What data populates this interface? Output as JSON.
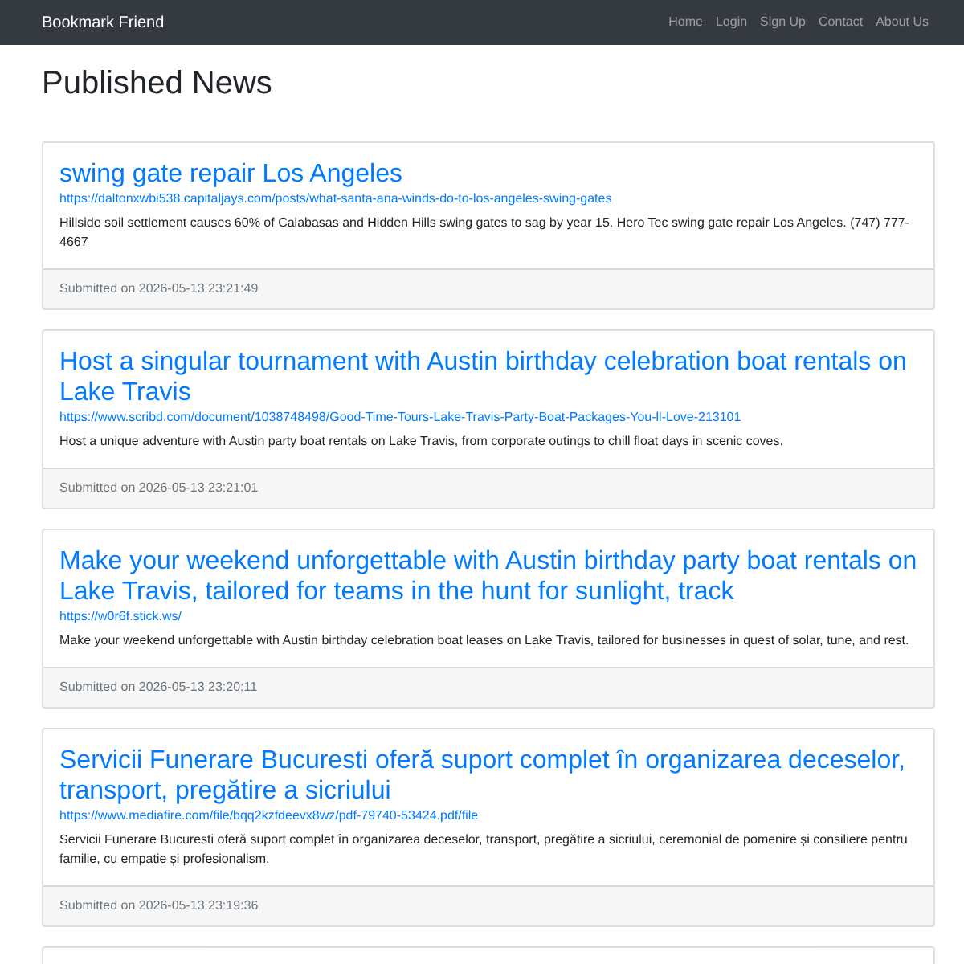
{
  "navbar": {
    "brand": "Bookmark Friend",
    "links": [
      {
        "label": "Home"
      },
      {
        "label": "Login"
      },
      {
        "label": "Sign Up"
      },
      {
        "label": "Contact"
      },
      {
        "label": "About Us"
      }
    ]
  },
  "page_title": "Published News",
  "posts": [
    {
      "title": "swing gate repair Los Angeles",
      "url": "https://daltonxwbi538.capitaljays.com/posts/what-santa-ana-winds-do-to-los-angeles-swing-gates",
      "summary": "Hillside soil settlement causes 60% of Calabasas and Hidden Hills swing gates to sag by year 15. Hero Tec swing gate repair Los Angeles. (747) 777-4667",
      "submitted": "Submitted on 2026-05-13 23:21:49"
    },
    {
      "title": "Host a singular tournament with Austin birthday celebration boat rentals on Lake Travis",
      "url": "https://www.scribd.com/document/1038748498/Good-Time-Tours-Lake-Travis-Party-Boat-Packages-You-ll-Love-213101",
      "summary": "Host a unique adventure with Austin party boat rentals on Lake Travis, from corporate outings to chill float days in scenic coves.",
      "submitted": "Submitted on 2026-05-13 23:21:01"
    },
    {
      "title": "Make your weekend unforgettable with Austin birthday party boat rentals on Lake Travis, tailored for teams in the hunt for sunlight, track",
      "url": "https://w0r6f.stick.ws/",
      "summary": "Make your weekend unforgettable with Austin birthday celebration boat leases on Lake Travis, tailored for businesses in quest of solar, tune, and rest.",
      "submitted": "Submitted on 2026-05-13 23:20:11"
    },
    {
      "title": "Servicii Funerare Bucuresti oferă suport complet în organizarea deceselor, transport, pregătire a sicriului",
      "url": "https://www.mediafire.com/file/bqq2kzfdeevx8wz/pdf-79740-53424.pdf/file",
      "summary": "Servicii Funerare Bucuresti oferă suport complet în organizarea deceselor, transport, pregătire a sicriului, ceremonial de pomenire și consiliere pentru familie, cu empatie și profesionalism.",
      "submitted": "Submitted on 2026-05-13 23:19:36"
    }
  ]
}
